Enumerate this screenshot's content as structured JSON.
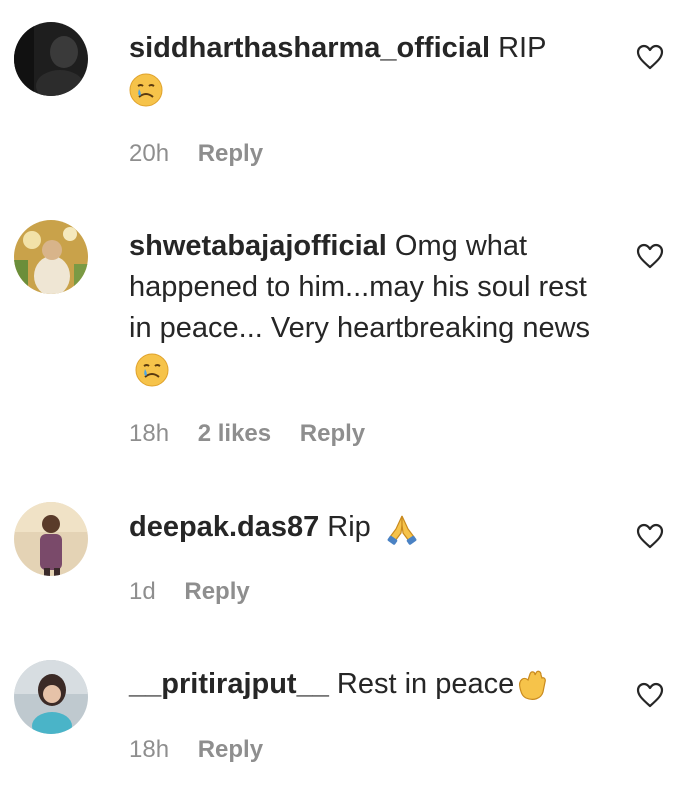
{
  "comments": [
    {
      "username": "siddharthasharma_official",
      "text": "RIP",
      "emoji": "crying-face",
      "time": "20h",
      "likes": "",
      "reply": "Reply",
      "heart": "heart-outline-icon"
    },
    {
      "username": "shwetabajajofficial",
      "text": "Omg what happened to him...may his soul rest in peace... Very heartbreaking news",
      "emoji": "crying-face",
      "time": "18h",
      "likes": "2 likes",
      "reply": "Reply",
      "heart": "heart-outline-icon"
    },
    {
      "username": "deepak.das87",
      "text": "Rip",
      "emoji": "folded-hands",
      "time": "1d",
      "likes": "",
      "reply": "Reply",
      "heart": "heart-outline-icon"
    },
    {
      "username": "__pritirajput__",
      "text": "Rest in peace",
      "emoji": "waving-hand",
      "time": "18h",
      "likes": "",
      "reply": "Reply",
      "heart": "heart-outline-icon"
    }
  ]
}
